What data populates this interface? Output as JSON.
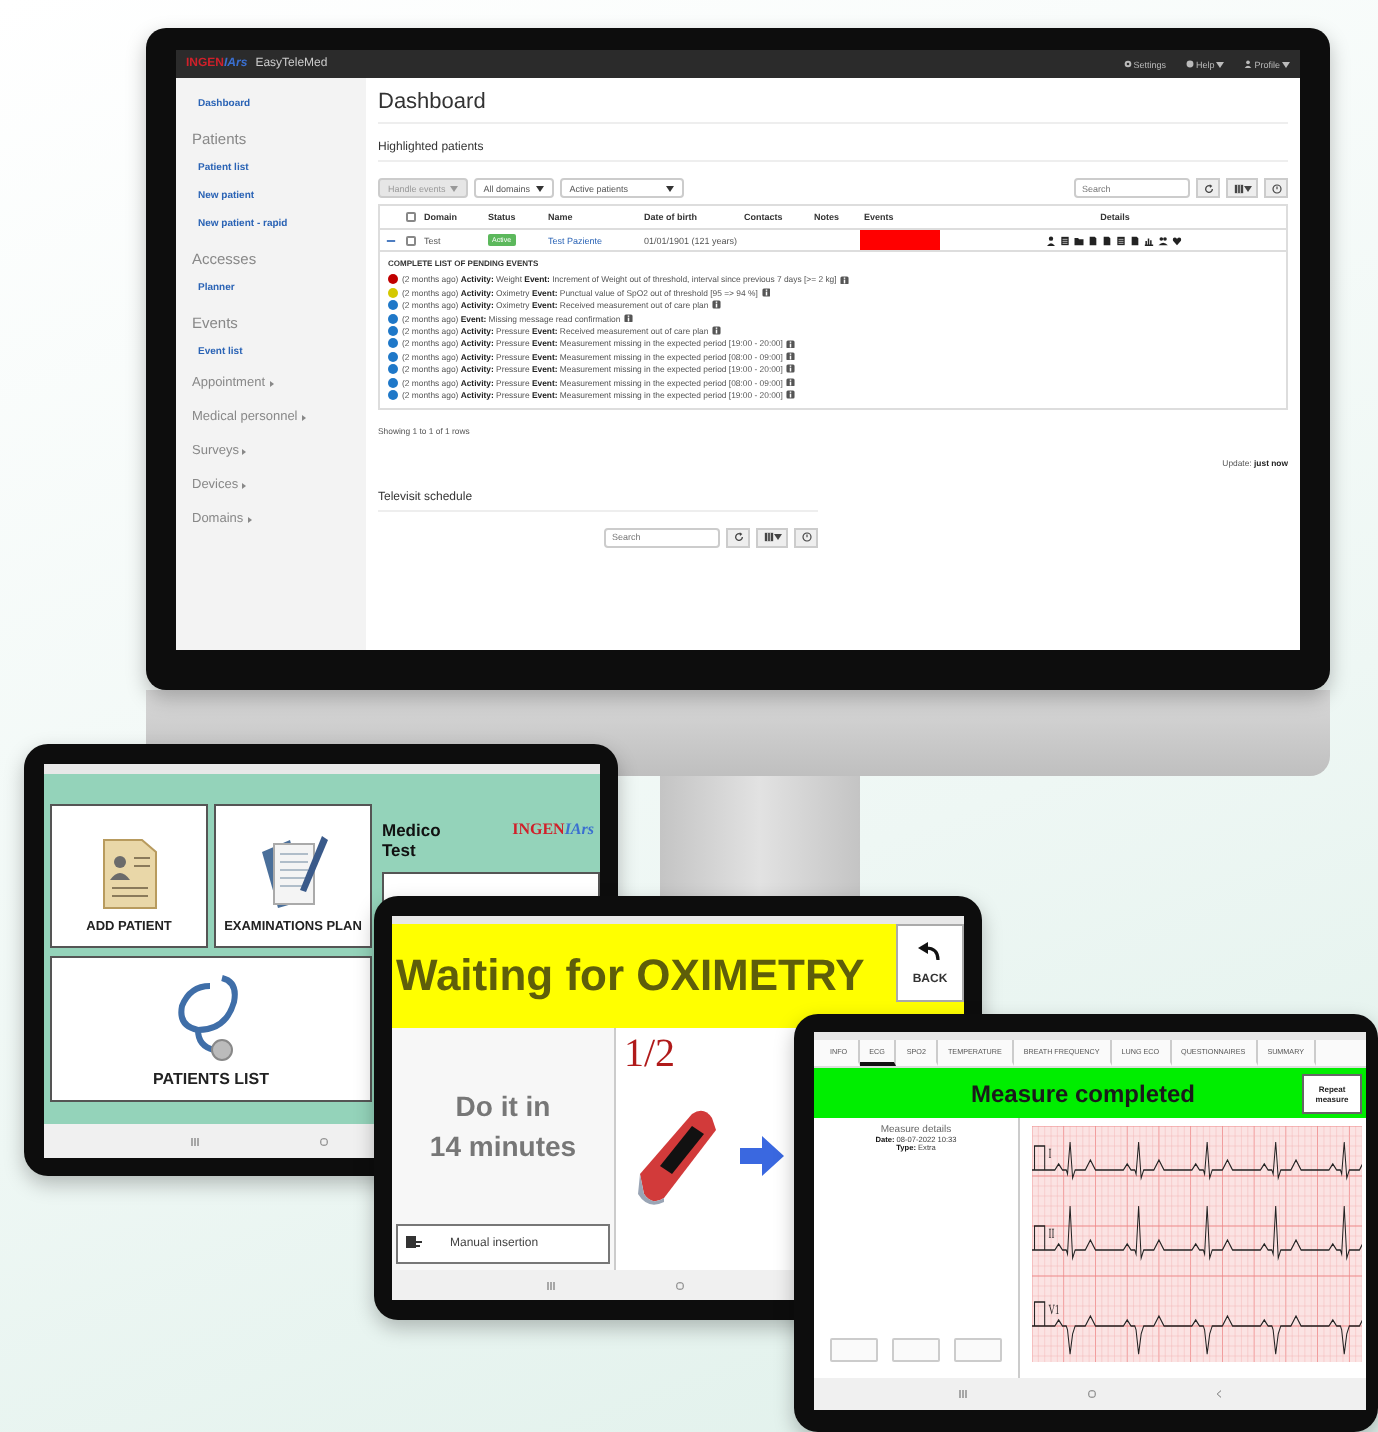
{
  "monitor": {
    "topbar": {
      "logo_left": "INGEN",
      "logo_right": "IArs",
      "app_name": "EasyTeleMed",
      "menu": [
        "Settings",
        "Help",
        "Profile"
      ]
    },
    "sidebar": [
      {
        "kind": "link",
        "label": "Dashboard"
      },
      {
        "kind": "header",
        "label": "Patients"
      },
      {
        "kind": "link",
        "label": "Patient list"
      },
      {
        "kind": "link",
        "label": "New patient"
      },
      {
        "kind": "link",
        "label": "New patient - rapid"
      },
      {
        "kind": "header",
        "label": "Accesses"
      },
      {
        "kind": "link",
        "label": "Planner"
      },
      {
        "kind": "header",
        "label": "Events"
      },
      {
        "kind": "link",
        "label": "Event list"
      },
      {
        "kind": "menu",
        "label": "Appointment"
      },
      {
        "kind": "menu",
        "label": "Medical personnel"
      },
      {
        "kind": "menu",
        "label": "Surveys"
      },
      {
        "kind": "menu",
        "label": "Devices"
      },
      {
        "kind": "menu",
        "label": "Domains"
      }
    ],
    "title": "Dashboard",
    "section": "Highlighted patients",
    "toolbar": {
      "handle_events": {
        "label": "Handle events",
        "disabled": true
      },
      "domain_select": "All domains",
      "patients_select": "Active patients",
      "search": {
        "placeholder": "Search"
      }
    },
    "table": {
      "columns": [
        "Domain",
        "Status",
        "Name",
        "Date of birth",
        "Contacts",
        "Notes",
        "Events",
        "Details"
      ],
      "header_checked": false,
      "rows": [
        {
          "expanded": true,
          "checked": false,
          "domain": "Test",
          "status": "Active",
          "name": "Test Paziente",
          "birth": "01/01/1901 (121 years)"
        }
      ]
    },
    "events_title": "COMPLETE LIST OF PENDING EVENTS",
    "events": [
      {
        "color": "#c00000",
        "text": "(2 months ago) **Activity:** Weight  **Event:** Increment of Weight out of threshold, interval since previous 7 days [>= 2 kg]"
      },
      {
        "color": "#d4c800",
        "text": "(2 months ago) **Activity:** Oximetry  **Event:** Punctual value of SpO2 out of threshold [95 => 94 %]"
      },
      {
        "color": "#1f78c8",
        "text": "(2 months ago) **Activity:** Oximetry  **Event:** Received measurement out of care plan"
      },
      {
        "color": "#1f78c8",
        "text": "(2 months ago) **Event:** Missing message read confirmation"
      },
      {
        "color": "#1f78c8",
        "text": "(2 months ago) **Activity:** Pressure  **Event:** Received measurement out of care plan"
      },
      {
        "color": "#1f78c8",
        "text": "(2 months ago) **Activity:** Pressure  **Event:** Measurement missing in the expected period [19:00 - 20:00]"
      },
      {
        "color": "#1f78c8",
        "text": "(2 months ago) **Activity:** Pressure  **Event:** Measurement missing in the expected period [08:00 - 09:00]"
      },
      {
        "color": "#1f78c8",
        "text": "(2 months ago) **Activity:** Pressure  **Event:** Measurement missing in the expected period [19:00 - 20:00]"
      },
      {
        "color": "#1f78c8",
        "text": "(2 months ago) **Activity:** Pressure  **Event:** Measurement missing in the expected period [08:00 - 09:00]"
      },
      {
        "color": "#1f78c8",
        "text": "(2 months ago) **Activity:** Pressure  **Event:** Measurement missing in the expected period [19:00 - 20:00]"
      }
    ],
    "showing": "Showing 1 to 1 of 1 rows",
    "update": "Update: **just now**",
    "televisit": {
      "title": "Televisit schedule",
      "search": {
        "placeholder": "Search"
      }
    }
  },
  "tablet_menu": {
    "tiles": [
      {
        "kind": "folder",
        "label": "ADD PATIENT"
      },
      {
        "kind": "notebook",
        "label": "EXAMINATIONS PLAN"
      },
      {
        "kind": "stethoscope",
        "label": "PATIENTS LIST"
      }
    ],
    "user": "Medico Test",
    "logo_left": "INGEN",
    "logo_right": "IArs"
  },
  "tablet_wait": {
    "title": "Waiting for OXIMETRY",
    "back": "BACK",
    "countdown": "Do it in\n14 minutes",
    "step": "1/2",
    "manual": "Manual insertion"
  },
  "tablet_ecg": {
    "tabs": [
      {
        "label": "INFO",
        "selected": false
      },
      {
        "label": "ECG",
        "selected": true
      },
      {
        "label": "SPO2",
        "selected": false
      },
      {
        "label": "TEMPERATURE",
        "selected": false
      },
      {
        "label": "BREATH FREQUENCY",
        "selected": false
      },
      {
        "label": "LUNG ECO",
        "selected": false
      },
      {
        "label": "QUESTIONNAIRES",
        "selected": false
      },
      {
        "label": "SUMMARY",
        "selected": false
      }
    ],
    "title": "Measure completed",
    "repeat": "Repeat measure",
    "details_title": "Measure details",
    "details": [
      "**Date:** 08-07-2022 10:33",
      "**Type:** Extra"
    ],
    "leads": [
      "I",
      "II",
      "V1"
    ]
  }
}
